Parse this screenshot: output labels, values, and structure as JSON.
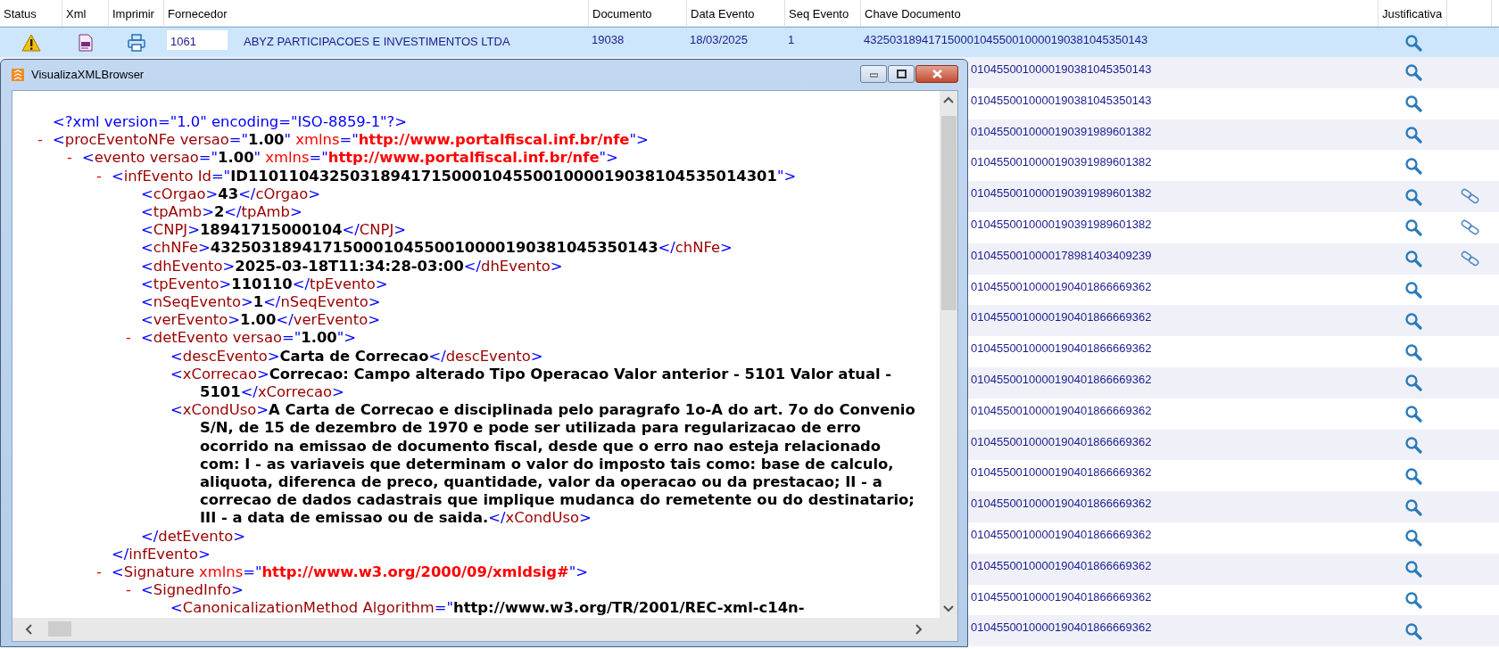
{
  "table": {
    "columns": [
      "Status",
      "Xml",
      "Imprimir",
      "Fornecedor",
      "Documento",
      "Data Evento",
      "Seq Evento",
      "Chave Documento",
      "Justificativa"
    ],
    "rows": [
      {
        "selected": true,
        "status": {
          "kind": "warning"
        },
        "fornecedor_codigo": "1061",
        "fornecedor": "ABYZ PARTICIPACOES E INVESTIMENTOS LTDA",
        "documento": "19038",
        "data_evento": "18/03/2025",
        "seq_evento": "1",
        "chave": "43250318941715000104550010000190381045350143",
        "linked": false
      },
      {
        "selected": false,
        "chave": "0104550010000190381045350143",
        "linked": false
      },
      {
        "selected": false,
        "chave": "0104550010000190381045350143",
        "linked": false
      },
      {
        "selected": false,
        "chave": "0104550010000190391989601382",
        "linked": false
      },
      {
        "selected": false,
        "chave": "0104550010000190391989601382",
        "linked": false
      },
      {
        "selected": false,
        "chave": "0104550010000190391989601382",
        "linked": true
      },
      {
        "selected": false,
        "chave": "0104550010000190391989601382",
        "linked": true
      },
      {
        "selected": false,
        "chave": "0104550010000178981403409239",
        "linked": true
      },
      {
        "selected": false,
        "chave": "0104550010000190401866669362",
        "linked": false
      },
      {
        "selected": false,
        "chave": "0104550010000190401866669362",
        "linked": false
      },
      {
        "selected": false,
        "chave": "0104550010000190401866669362",
        "linked": false
      },
      {
        "selected": false,
        "chave": "0104550010000190401866669362",
        "linked": false
      },
      {
        "selected": false,
        "chave": "0104550010000190401866669362",
        "linked": false
      },
      {
        "selected": false,
        "chave": "0104550010000190401866669362",
        "linked": false
      },
      {
        "selected": false,
        "chave": "0104550010000190401866669362",
        "linked": false
      },
      {
        "selected": false,
        "chave": "0104550010000190401866669362",
        "linked": false
      },
      {
        "selected": false,
        "chave": "0104550010000190401866669362",
        "linked": false
      },
      {
        "selected": false,
        "chave": "0104550010000190401866669362",
        "linked": false
      },
      {
        "selected": false,
        "chave": "0104550010000190401866669362",
        "linked": false
      },
      {
        "selected": false,
        "chave": "0104550010000190401866669362",
        "linked": false
      }
    ]
  },
  "window": {
    "title": "VisualizaXMLBrowser",
    "nodes": [
      {
        "open": [
          {
            "kind": "markup",
            "text": "<?xml version=\"1.0\" encoding=\"ISO-8859-1\"?>"
          }
        ]
      },
      {
        "toggle": "-",
        "open": [
          {
            "kind": "markup",
            "text": "<"
          },
          {
            "kind": "name",
            "text": "procEventoNFe"
          },
          {
            "kind": "name",
            "text": " versao"
          },
          {
            "kind": "markup",
            "text": "=\""
          },
          {
            "kind": "value",
            "text": "1.00"
          },
          {
            "kind": "markup",
            "text": "\""
          },
          {
            "kind": "ns_name",
            "text": " xmlns"
          },
          {
            "kind": "markup",
            "text": "=\""
          },
          {
            "kind": "ns_value",
            "text": "http://www.portalfiscal.inf.br/nfe"
          },
          {
            "kind": "markup",
            "text": "\">"
          }
        ],
        "children": [
          {
            "toggle": "-",
            "open": [
              {
                "kind": "markup",
                "text": "<"
              },
              {
                "kind": "name",
                "text": "evento"
              },
              {
                "kind": "name",
                "text": " versao"
              },
              {
                "kind": "markup",
                "text": "=\""
              },
              {
                "kind": "value",
                "text": "1.00"
              },
              {
                "kind": "markup",
                "text": "\""
              },
              {
                "kind": "ns_name",
                "text": " xmlns"
              },
              {
                "kind": "markup",
                "text": "=\""
              },
              {
                "kind": "ns_value",
                "text": "http://www.portalfiscal.inf.br/nfe"
              },
              {
                "kind": "markup",
                "text": "\">"
              }
            ],
            "children": [
              {
                "toggle": "-",
                "open": [
                  {
                    "kind": "markup",
                    "text": "<"
                  },
                  {
                    "kind": "name",
                    "text": "infEvento"
                  },
                  {
                    "kind": "name",
                    "text": " Id"
                  },
                  {
                    "kind": "markup",
                    "text": "=\""
                  },
                  {
                    "kind": "value",
                    "text": "ID1101104325031894171500010455001000019038104535014301"
                  },
                  {
                    "kind": "markup",
                    "text": "\">"
                  }
                ],
                "close": [
                  {
                    "kind": "markup",
                    "text": "</"
                  },
                  {
                    "kind": "name",
                    "text": "infEvento"
                  },
                  {
                    "kind": "markup",
                    "text": ">"
                  }
                ],
                "children": [
                  {
                    "open": [
                      {
                        "kind": "markup",
                        "text": "<"
                      },
                      {
                        "kind": "name",
                        "text": "cOrgao"
                      },
                      {
                        "kind": "markup",
                        "text": ">"
                      }
                    ],
                    "text": "43",
                    "close": [
                      {
                        "kind": "markup",
                        "text": "</"
                      },
                      {
                        "kind": "name",
                        "text": "cOrgao"
                      },
                      {
                        "kind": "markup",
                        "text": ">"
                      }
                    ]
                  },
                  {
                    "open": [
                      {
                        "kind": "markup",
                        "text": "<"
                      },
                      {
                        "kind": "name",
                        "text": "tpAmb"
                      },
                      {
                        "kind": "markup",
                        "text": ">"
                      }
                    ],
                    "text": "2",
                    "close": [
                      {
                        "kind": "markup",
                        "text": "</"
                      },
                      {
                        "kind": "name",
                        "text": "tpAmb"
                      },
                      {
                        "kind": "markup",
                        "text": ">"
                      }
                    ]
                  },
                  {
                    "open": [
                      {
                        "kind": "markup",
                        "text": "<"
                      },
                      {
                        "kind": "name",
                        "text": "CNPJ"
                      },
                      {
                        "kind": "markup",
                        "text": ">"
                      }
                    ],
                    "text": "18941715000104",
                    "close": [
                      {
                        "kind": "markup",
                        "text": "</"
                      },
                      {
                        "kind": "name",
                        "text": "CNPJ"
                      },
                      {
                        "kind": "markup",
                        "text": ">"
                      }
                    ]
                  },
                  {
                    "open": [
                      {
                        "kind": "markup",
                        "text": "<"
                      },
                      {
                        "kind": "name",
                        "text": "chNFe"
                      },
                      {
                        "kind": "markup",
                        "text": ">"
                      }
                    ],
                    "text": "43250318941715000104550010000190381045350143",
                    "close": [
                      {
                        "kind": "markup",
                        "text": "</"
                      },
                      {
                        "kind": "name",
                        "text": "chNFe"
                      },
                      {
                        "kind": "markup",
                        "text": ">"
                      }
                    ]
                  },
                  {
                    "open": [
                      {
                        "kind": "markup",
                        "text": "<"
                      },
                      {
                        "kind": "name",
                        "text": "dhEvento"
                      },
                      {
                        "kind": "markup",
                        "text": ">"
                      }
                    ],
                    "text": "2025-03-18T11:34:28-03:00",
                    "close": [
                      {
                        "kind": "markup",
                        "text": "</"
                      },
                      {
                        "kind": "name",
                        "text": "dhEvento"
                      },
                      {
                        "kind": "markup",
                        "text": ">"
                      }
                    ]
                  },
                  {
                    "open": [
                      {
                        "kind": "markup",
                        "text": "<"
                      },
                      {
                        "kind": "name",
                        "text": "tpEvento"
                      },
                      {
                        "kind": "markup",
                        "text": ">"
                      }
                    ],
                    "text": "110110",
                    "close": [
                      {
                        "kind": "markup",
                        "text": "</"
                      },
                      {
                        "kind": "name",
                        "text": "tpEvento"
                      },
                      {
                        "kind": "markup",
                        "text": ">"
                      }
                    ]
                  },
                  {
                    "open": [
                      {
                        "kind": "markup",
                        "text": "<"
                      },
                      {
                        "kind": "name",
                        "text": "nSeqEvento"
                      },
                      {
                        "kind": "markup",
                        "text": ">"
                      }
                    ],
                    "text": "1",
                    "close": [
                      {
                        "kind": "markup",
                        "text": "</"
                      },
                      {
                        "kind": "name",
                        "text": "nSeqEvento"
                      },
                      {
                        "kind": "markup",
                        "text": ">"
                      }
                    ]
                  },
                  {
                    "open": [
                      {
                        "kind": "markup",
                        "text": "<"
                      },
                      {
                        "kind": "name",
                        "text": "verEvento"
                      },
                      {
                        "kind": "markup",
                        "text": ">"
                      }
                    ],
                    "text": "1.00",
                    "close": [
                      {
                        "kind": "markup",
                        "text": "</"
                      },
                      {
                        "kind": "name",
                        "text": "verEvento"
                      },
                      {
                        "kind": "markup",
                        "text": ">"
                      }
                    ]
                  },
                  {
                    "toggle": "-",
                    "open": [
                      {
                        "kind": "markup",
                        "text": "<"
                      },
                      {
                        "kind": "name",
                        "text": "detEvento"
                      },
                      {
                        "kind": "name",
                        "text": " versao"
                      },
                      {
                        "kind": "markup",
                        "text": "=\""
                      },
                      {
                        "kind": "value",
                        "text": "1.00"
                      },
                      {
                        "kind": "markup",
                        "text": "\">"
                      }
                    ],
                    "close": [
                      {
                        "kind": "markup",
                        "text": "</"
                      },
                      {
                        "kind": "name",
                        "text": "detEvento"
                      },
                      {
                        "kind": "markup",
                        "text": ">"
                      }
                    ],
                    "children": [
                      {
                        "open": [
                          {
                            "kind": "markup",
                            "text": "<"
                          },
                          {
                            "kind": "name",
                            "text": "descEvento"
                          },
                          {
                            "kind": "markup",
                            "text": ">"
                          }
                        ],
                        "text": "Carta de Correcao",
                        "close": [
                          {
                            "kind": "markup",
                            "text": "</"
                          },
                          {
                            "kind": "name",
                            "text": "descEvento"
                          },
                          {
                            "kind": "markup",
                            "text": ">"
                          }
                        ]
                      },
                      {
                        "open": [
                          {
                            "kind": "markup",
                            "text": "<"
                          },
                          {
                            "kind": "name",
                            "text": "xCorrecao"
                          },
                          {
                            "kind": "markup",
                            "text": ">"
                          }
                        ],
                        "text": "Correcao: Campo alterado Tipo Operacao Valor anterior - 5101 Valor atual - 5101",
                        "close": [
                          {
                            "kind": "markup",
                            "text": "</"
                          },
                          {
                            "kind": "name",
                            "text": "xCorrecao"
                          },
                          {
                            "kind": "markup",
                            "text": ">"
                          }
                        ]
                      },
                      {
                        "open": [
                          {
                            "kind": "markup",
                            "text": "<"
                          },
                          {
                            "kind": "name",
                            "text": "xCondUso"
                          },
                          {
                            "kind": "markup",
                            "text": ">"
                          }
                        ],
                        "text": "A Carta de Correcao e disciplinada pelo paragrafo 1o-A do art. 7o do Convenio S/N, de 15 de dezembro de 1970 e pode ser utilizada para regularizacao de erro ocorrido na emissao de documento fiscal, desde que o erro nao esteja relacionado com: I - as variaveis que determinam o valor do imposto tais como: base de calculo, aliquota, diferenca de preco, quantidade, valor da operacao ou da prestacao; II - a correcao de dados cadastrais que implique mudanca do remetente ou do destinatario; III - a data de emissao ou de saida.",
                        "close": [
                          {
                            "kind": "markup",
                            "text": "</"
                          },
                          {
                            "kind": "name",
                            "text": "xCondUso"
                          },
                          {
                            "kind": "markup",
                            "text": ">"
                          }
                        ]
                      }
                    ]
                  }
                ]
              },
              {
                "toggle": "-",
                "open": [
                  {
                    "kind": "markup",
                    "text": "<"
                  },
                  {
                    "kind": "name",
                    "text": "Signature"
                  },
                  {
                    "kind": "ns_name",
                    "text": " xmlns"
                  },
                  {
                    "kind": "markup",
                    "text": "=\""
                  },
                  {
                    "kind": "ns_value",
                    "text": "http://www.w3.org/2000/09/xmldsig#"
                  },
                  {
                    "kind": "markup",
                    "text": "\">"
                  }
                ],
                "children": [
                  {
                    "toggle": "-",
                    "open": [
                      {
                        "kind": "markup",
                        "text": "<"
                      },
                      {
                        "kind": "name",
                        "text": "SignedInfo"
                      },
                      {
                        "kind": "markup",
                        "text": ">"
                      }
                    ],
                    "children": [
                      {
                        "open": [
                          {
                            "kind": "markup",
                            "text": "<"
                          },
                          {
                            "kind": "name",
                            "text": "CanonicalizationMethod"
                          },
                          {
                            "kind": "name",
                            "text": " Algorithm"
                          },
                          {
                            "kind": "markup",
                            "text": "=\""
                          },
                          {
                            "kind": "value",
                            "text": "http://www.w3.org/TR/2001/REC-xml-c14n-"
                          }
                        ]
                      }
                    ]
                  }
                ]
              }
            ]
          }
        ]
      }
    ]
  }
}
